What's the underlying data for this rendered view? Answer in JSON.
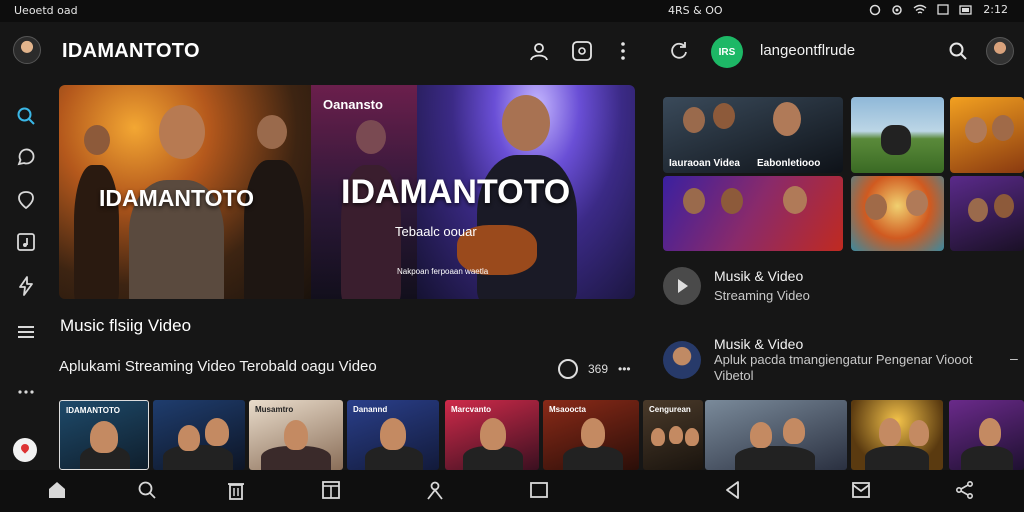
{
  "status_bar": {
    "left_text": "Ueoetd oad",
    "center_text": "4RS & OO",
    "time": "2:12"
  },
  "left_header": {
    "title": "IDAMANTOTO",
    "icons": [
      "profile-icon",
      "video-square-icon",
      "more-vertical-icon"
    ]
  },
  "sidebar": {
    "items": [
      "search-icon",
      "chat-icon",
      "shield-icon",
      "music-note-icon",
      "lightning-icon",
      "list-icon",
      "more-horizontal-icon",
      "location-pin-icon"
    ]
  },
  "hero": {
    "left_title": "IDAMANTOTO",
    "center_title": "IDAMANTOTO",
    "top_label": "Oanansto",
    "mid_label": "Tebaalc oouar",
    "small_caption": "Nakpoan ferpoaan waetla"
  },
  "main": {
    "section_title": "Music flsiig Video",
    "subtitle": "Aplukami Streaming Video Terobald oagu Video",
    "counter": "369",
    "arrow": "•••"
  },
  "thumb_strip": {
    "items": [
      {
        "label": "IDAMANTOTO"
      },
      {
        "label": ""
      },
      {
        "label": "Musamtro"
      },
      {
        "label": "Danannd"
      },
      {
        "label": "Marcvanto"
      },
      {
        "label": "Msaoocta"
      },
      {
        "label": "Cengurean"
      },
      {
        "label": ""
      },
      {
        "label": ""
      },
      {
        "label": ""
      }
    ]
  },
  "right_header": {
    "badge_text": "IRS",
    "title": "langeontflrude"
  },
  "right_grid": {
    "tiles": [
      {
        "caption": "Iauraoan Videa"
      },
      {
        "caption": "Eabonletiooo"
      },
      {
        "caption": ""
      },
      {
        "caption": ""
      },
      {
        "caption": ""
      },
      {
        "caption": ""
      },
      {
        "caption": ""
      },
      {
        "caption": ""
      }
    ]
  },
  "right_list": {
    "item1": {
      "title": "Musik & Video",
      "subtitle": "Streaming Video"
    },
    "item2": {
      "title": "Musik & Video",
      "subtitle": "Apluk pacda tmangiengatur Pengenar Viooot",
      "subtitle2": "Vibetol"
    }
  },
  "bottom_nav": {
    "icons": [
      "home-icon",
      "search-icon",
      "trash-icon",
      "panel-icon",
      "person-icon",
      "square-icon",
      "back-icon",
      "mail-icon",
      "share-icon"
    ]
  },
  "colors": {
    "background": "#161616",
    "accent_blue": "#3ab7e6",
    "badge_green": "#1db866"
  }
}
